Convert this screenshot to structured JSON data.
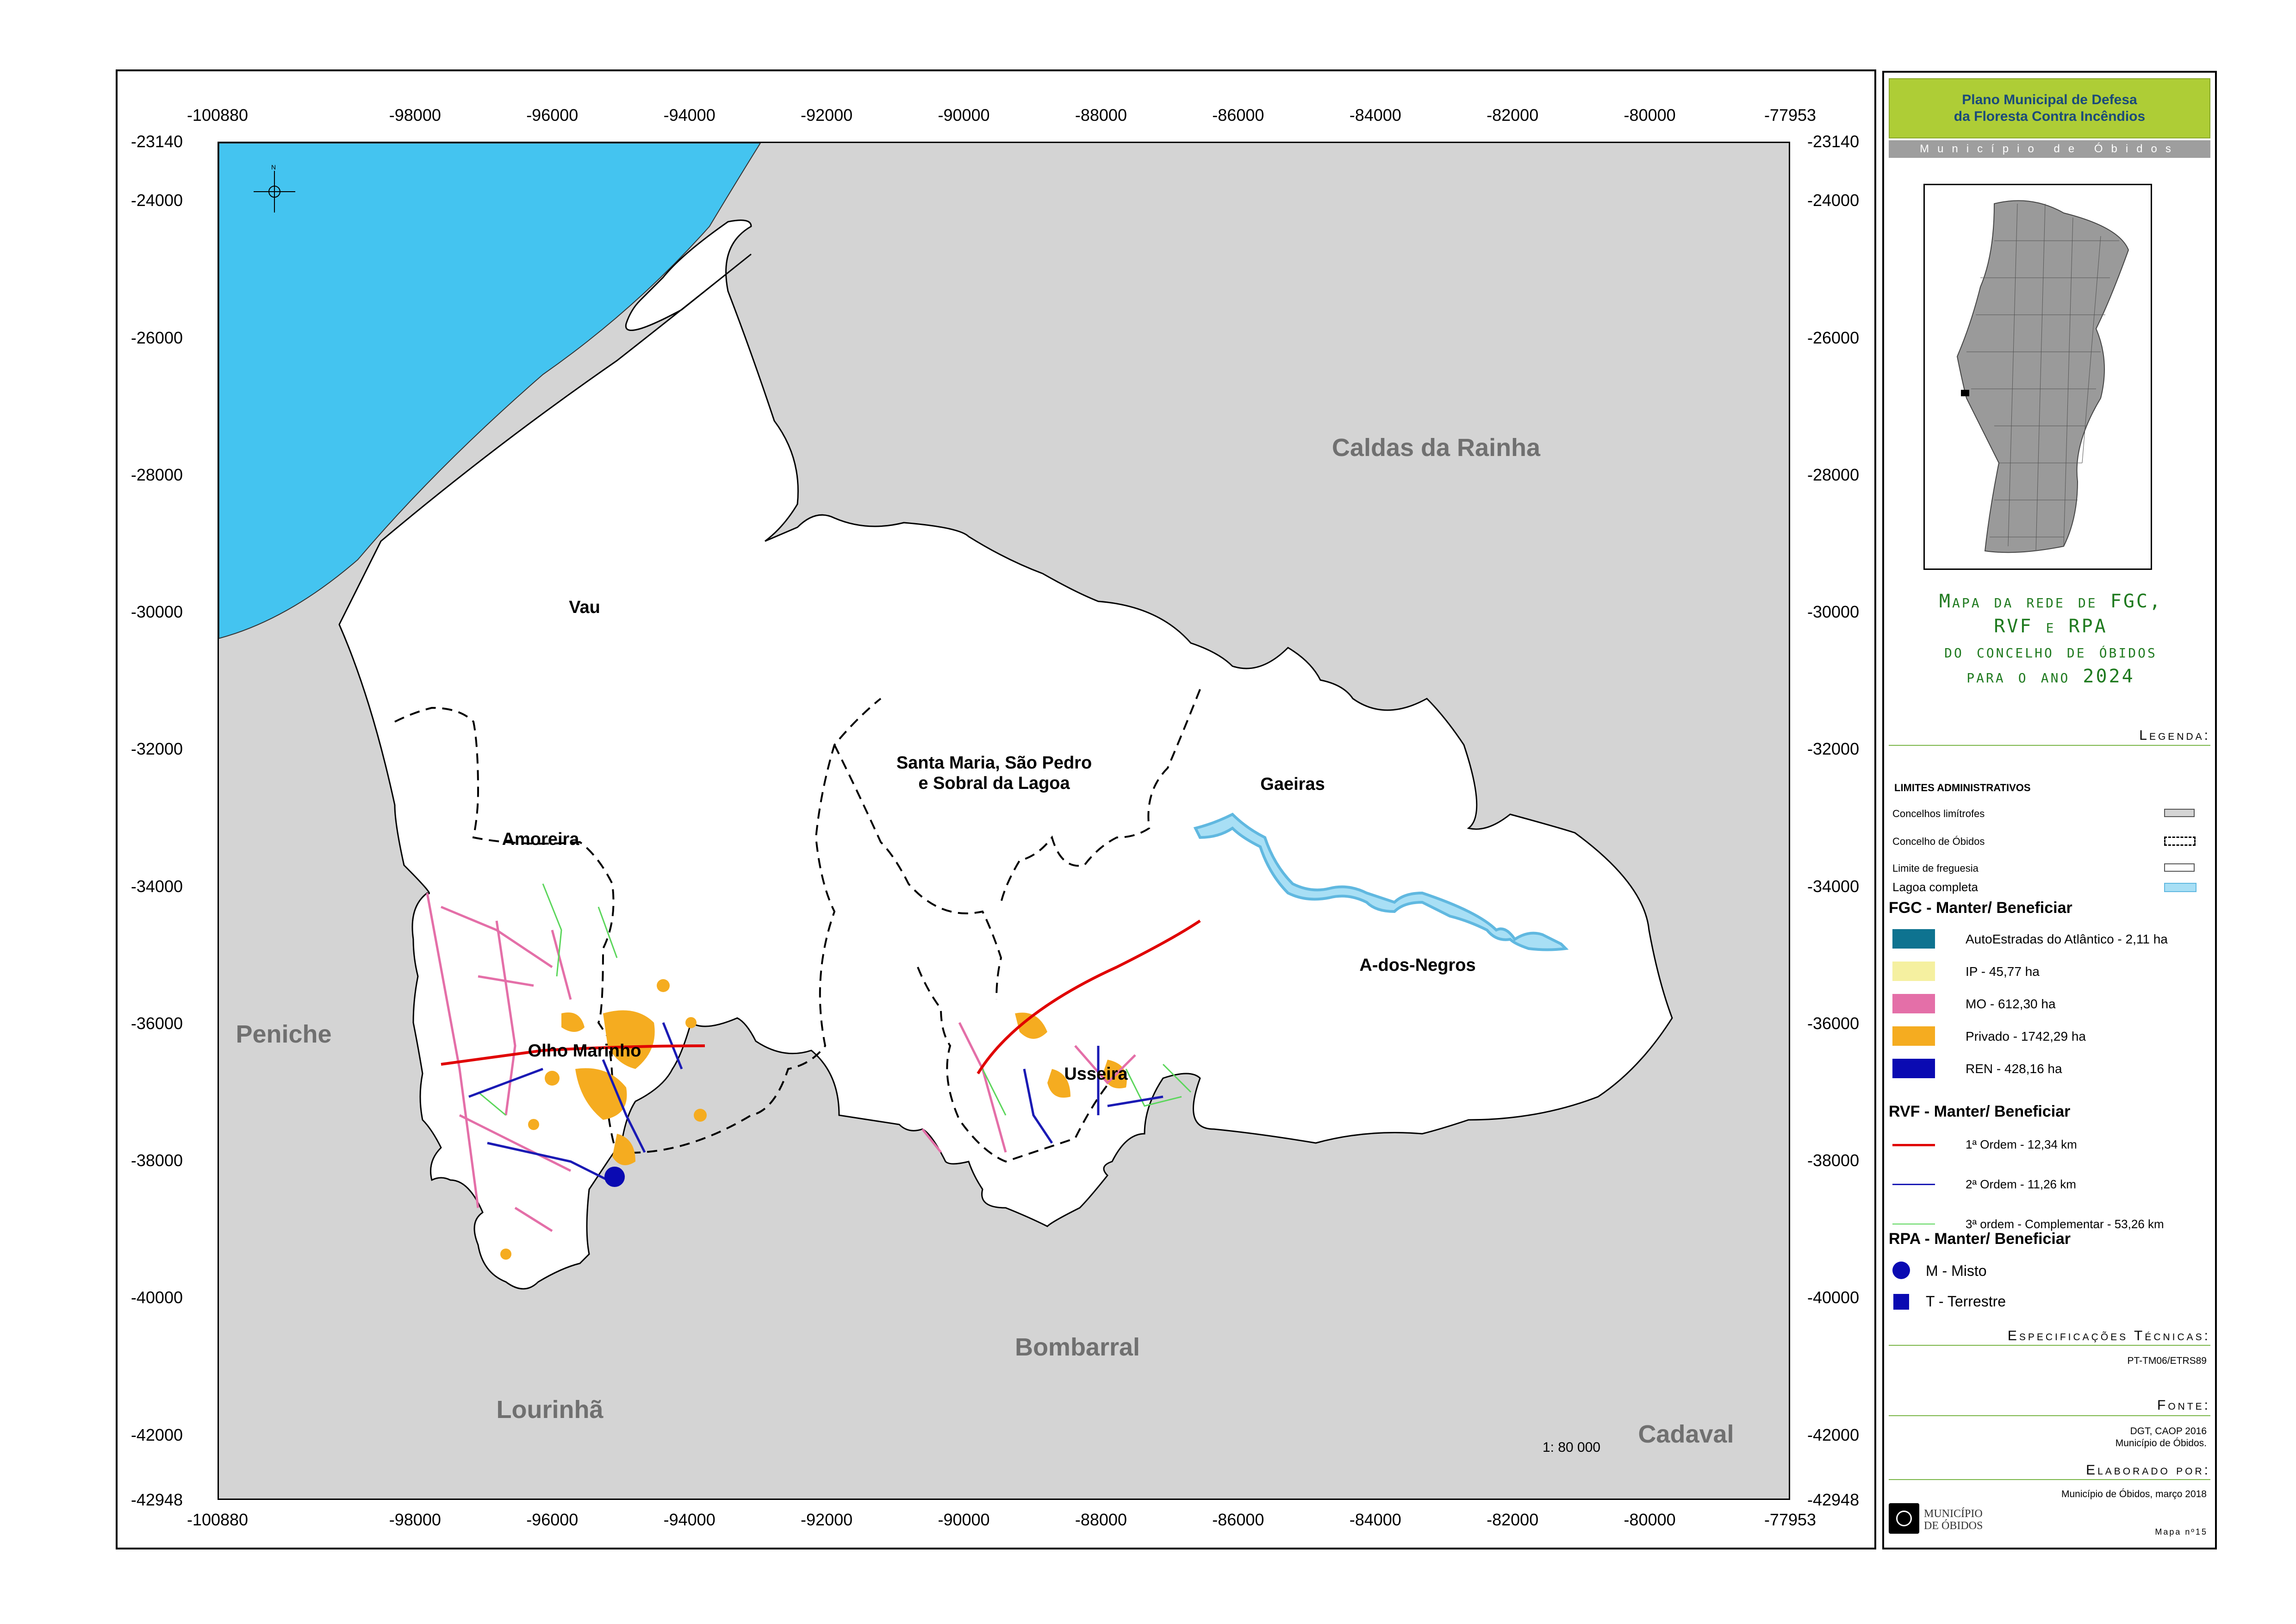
{
  "header": {
    "plan_line1": "Plano Municipal de Defesa",
    "plan_line2": "da Floresta Contra Incêndios",
    "municipality": "Município de Óbidos"
  },
  "map_title": {
    "line1": "Mapa da rede de FGC,",
    "line2": "RVF e RPA",
    "line3": "do concelho de óbidos",
    "line4": "para o ano 2024"
  },
  "axes": {
    "x_ticks": [
      "-100880",
      "-98000",
      "-96000",
      "-94000",
      "-92000",
      "-90000",
      "-88000",
      "-86000",
      "-84000",
      "-82000",
      "-80000",
      "-77953"
    ],
    "y_ticks": [
      "-23140",
      "-24000",
      "-26000",
      "-28000",
      "-30000",
      "-32000",
      "-34000",
      "-36000",
      "-38000",
      "-40000",
      "-42000",
      "-42948"
    ],
    "x_range": [
      -100880,
      -77953
    ],
    "y_range": [
      -42948,
      -23140
    ]
  },
  "places": {
    "vau": "Vau",
    "amoreira": "Amoreira",
    "santa_maria_1": "Santa Maria, São Pedro",
    "santa_maria_2": "e Sobral da Lagoa",
    "gaeiras": "Gaeiras",
    "a_dos_negros": "A-dos-Negros",
    "olho_marinho": "Olho Marinho",
    "usseira": "Usseira",
    "caldas": "Caldas da Rainha",
    "peniche": "Peniche",
    "lourinha": "Lourinhã",
    "bombarral": "Bombarral",
    "cadaval": "Cadaval"
  },
  "scale": "1: 80 000",
  "legend": {
    "title": "Legenda:",
    "admin_title": "LIMITES ADMINISTRATIVOS",
    "admin_items": [
      "Concelhos limítrofes",
      "Concelho de Óbidos",
      "Limite de freguesia",
      "Lagoa completa"
    ],
    "fgc_title": "FGC - Manter/ Beneficiar",
    "fgc_items": [
      {
        "label": "AutoEstradas do Atlântico - 2,11 ha",
        "color": "#0e7390"
      },
      {
        "label": "IP - 45,77 ha",
        "color": "#f5f0a0"
      },
      {
        "label": "MO - 612,30 ha",
        "color": "#e46fa8"
      },
      {
        "label": "Privado - 1742,29 ha",
        "color": "#f5ac20"
      },
      {
        "label": "REN - 428,16 ha",
        "color": "#0a0ab2"
      }
    ],
    "rvf_title": "RVF - Manter/ Beneficiar",
    "rvf_items": [
      {
        "label": "1ª Ordem - 12,34 km",
        "color": "#e00000"
      },
      {
        "label": "2ª Ordem - 11,26 km",
        "color": "#1a1ab4"
      },
      {
        "label": "3ª ordem - Complementar - 53,26 km",
        "color": "#5bd65b"
      }
    ],
    "rpa_title": "RPA - Manter/ Beneficiar",
    "rpa_items": [
      {
        "label": "M - Misto",
        "shape": "circle",
        "color": "#0a0ab2"
      },
      {
        "label": "T - Terrestre",
        "shape": "square",
        "color": "#0a0ab2"
      }
    ]
  },
  "specs": {
    "title": "Especificações Técnicas:",
    "value": "PT-TM06/ETRS89"
  },
  "source": {
    "title": "Fonte:",
    "line1": "DGT, CAOP 2016",
    "line2": "Município de Óbidos."
  },
  "author": {
    "title": "Elaborado por:",
    "value": "Município de Óbidos, março 2018"
  },
  "logo_text": "MUNICÍPIO DE ÓBIDOS",
  "map_number": "Mapa nº15",
  "colors": {
    "sea": "#44c4f0",
    "neighbor": "#d4d4d4",
    "municipality": "#ffffff",
    "lagoon": "#a8dff5",
    "header_green": "#aecd36",
    "title_green": "#1f7a1f"
  }
}
